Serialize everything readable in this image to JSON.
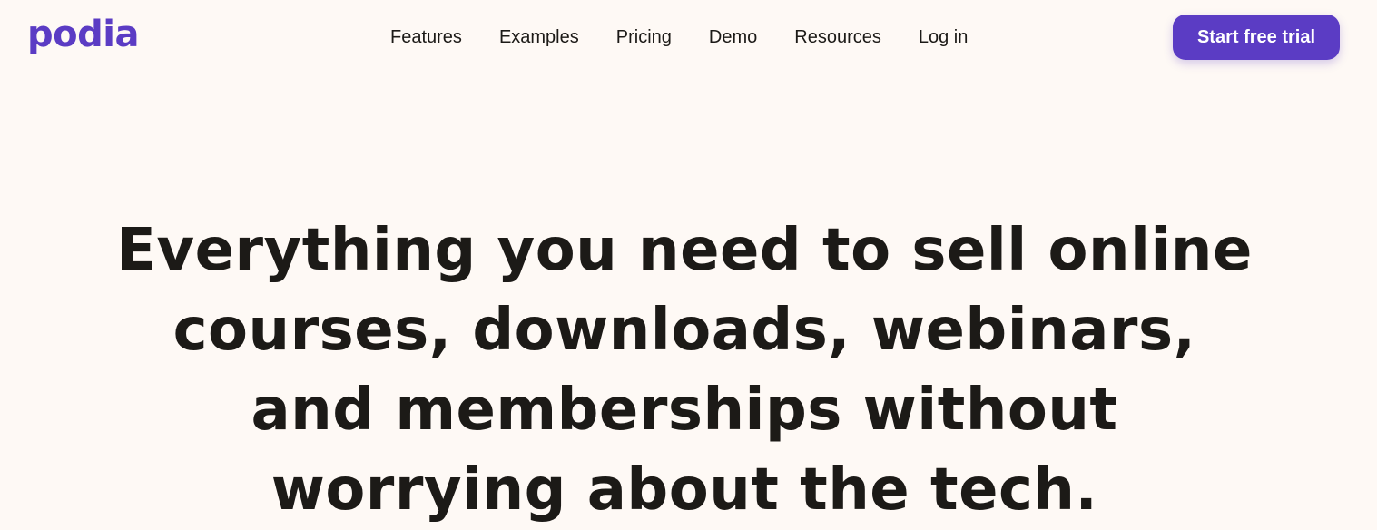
{
  "brand": {
    "name": "podia",
    "color": "#5b3cc4"
  },
  "nav": {
    "items": [
      {
        "label": "Features"
      },
      {
        "label": "Examples"
      },
      {
        "label": "Pricing"
      },
      {
        "label": "Demo"
      },
      {
        "label": "Resources"
      },
      {
        "label": "Log in"
      }
    ]
  },
  "cta": {
    "label": "Start free trial"
  },
  "hero": {
    "lines": [
      "Everything you need to sell online",
      "courses, downloads, webinars,",
      "and memberships without",
      "worrying about the tech."
    ]
  }
}
